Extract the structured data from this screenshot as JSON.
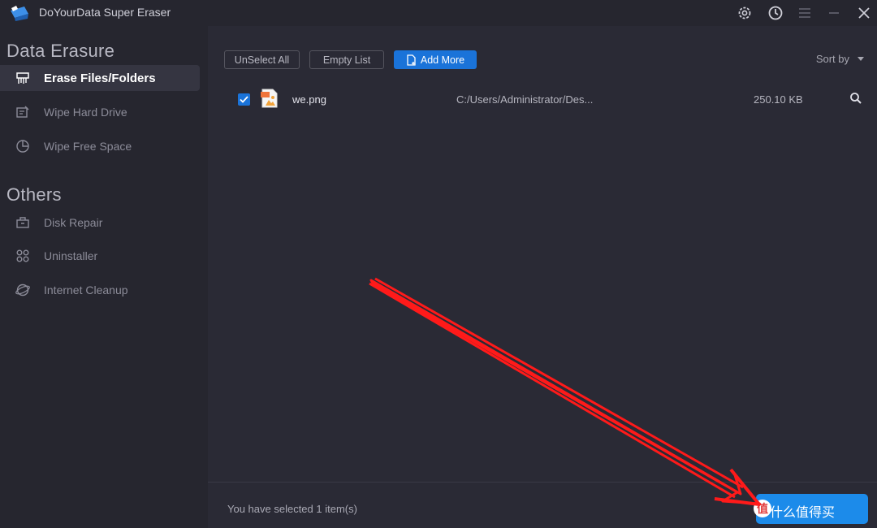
{
  "app": {
    "title": "DoYourData Super Eraser"
  },
  "titlebar": {
    "icons": [
      "gear-icon",
      "history-icon",
      "menu-icon",
      "minimize-icon",
      "close-icon"
    ]
  },
  "sidebar": {
    "sections": [
      {
        "title": "Data Erasure",
        "items": [
          {
            "label": "Erase Files/Folders",
            "icon": "shredder-icon",
            "active": true
          },
          {
            "label": "Wipe Hard Drive",
            "icon": "drive-icon",
            "active": false
          },
          {
            "label": "Wipe Free Space",
            "icon": "pie-icon",
            "active": false
          }
        ]
      },
      {
        "title": "Others",
        "items": [
          {
            "label": "Disk Repair",
            "icon": "toolbox-icon",
            "active": false
          },
          {
            "label": "Uninstaller",
            "icon": "apps-icon",
            "active": false
          },
          {
            "label": "Internet Cleanup",
            "icon": "globe-icon",
            "active": false
          }
        ]
      }
    ]
  },
  "toolbar": {
    "unselect_all": "UnSelect All",
    "empty_list": "Empty List",
    "add_more": "Add More",
    "sort_by": "Sort by"
  },
  "files": [
    {
      "checked": true,
      "name": "we.png",
      "path": "C:/Users/Administrator/Des...",
      "size": "250.10 KB"
    }
  ],
  "footer": {
    "status": "You have selected 1 item(s)",
    "watermark": "什么值得买",
    "watermark_badge": "值"
  },
  "colors": {
    "accent": "#1a73d9",
    "erase_button": "#1c8bea",
    "annotation_arrow": "#ff1a1a",
    "background": "#2a2a35",
    "sidebar": "#26262f"
  }
}
